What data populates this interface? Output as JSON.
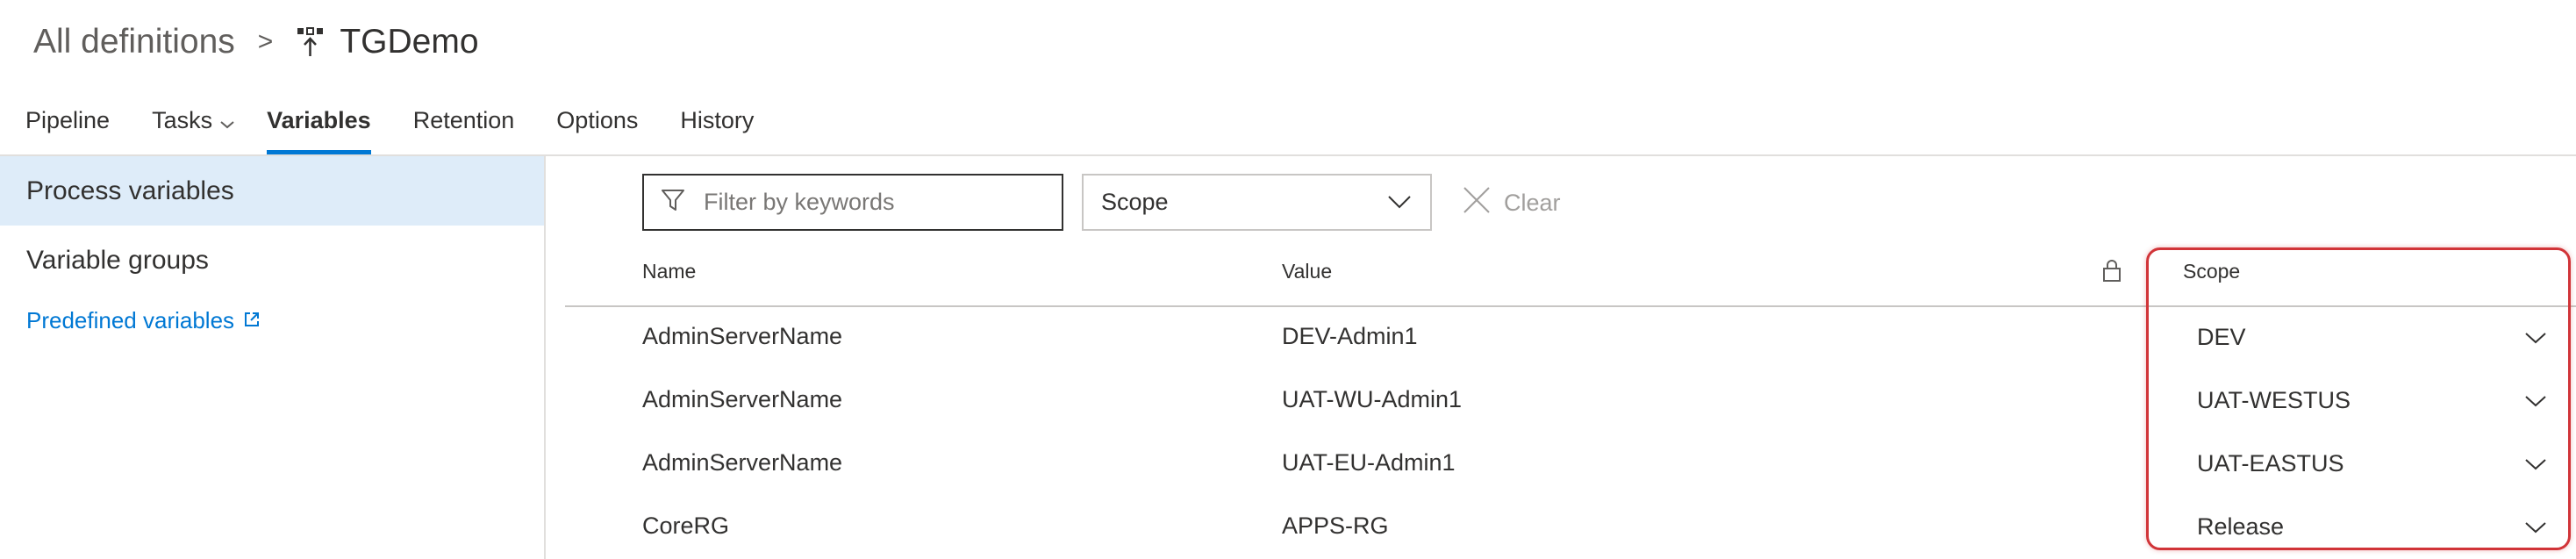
{
  "breadcrumb": {
    "root": "All definitions",
    "separator": ">",
    "current": "TGDemo",
    "icon": "release-definition-icon"
  },
  "tabs": [
    {
      "label": "Pipeline",
      "active": false
    },
    {
      "label": "Tasks",
      "active": false,
      "has_dropdown": true
    },
    {
      "label": "Variables",
      "active": true
    },
    {
      "label": "Retention",
      "active": false
    },
    {
      "label": "Options",
      "active": false
    },
    {
      "label": "History",
      "active": false
    }
  ],
  "leftnav": {
    "items": [
      {
        "label": "Process variables",
        "selected": true
      },
      {
        "label": "Variable groups",
        "selected": false
      }
    ],
    "link": {
      "label": "Predefined variables",
      "icon": "external-link-icon"
    }
  },
  "filter": {
    "placeholder": "Filter by keywords",
    "value": "",
    "icon": "filter-icon"
  },
  "scope_filter": {
    "label": "Scope",
    "icon": "chevron-down-icon"
  },
  "clear": {
    "label": "Clear",
    "icon": "close-icon"
  },
  "table": {
    "columns": {
      "name": "Name",
      "value": "Value",
      "secret_icon": "lock-icon",
      "scope": "Scope"
    },
    "rows": [
      {
        "name": "AdminServerName",
        "value": "DEV-Admin1",
        "scope": "DEV"
      },
      {
        "name": "AdminServerName",
        "value": "UAT-WU-Admin1",
        "scope": "UAT-WESTUS"
      },
      {
        "name": "AdminServerName",
        "value": "UAT-EU-Admin1",
        "scope": "UAT-EASTUS"
      },
      {
        "name": "CoreRG",
        "value": "APPS-RG",
        "scope": "Release"
      }
    ]
  },
  "colors": {
    "accent": "#0078d4",
    "selected_nav_bg": "#deecf9",
    "highlight_border": "#d13438"
  }
}
